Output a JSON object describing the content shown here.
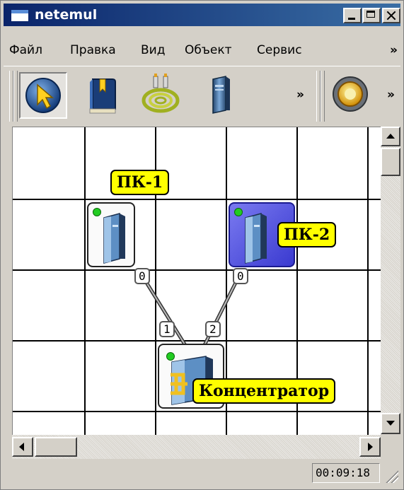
{
  "window": {
    "title": "netemul"
  },
  "menu": {
    "items": [
      "Файл",
      "Правка",
      "Вид",
      "Объект",
      "Сервис"
    ],
    "more": "»"
  },
  "toolbar": {
    "tools": [
      "pointer-tool",
      "note-tool",
      "cable-tool",
      "computer-tool"
    ],
    "more": "»",
    "settings": "settings-gear",
    "more2": "»"
  },
  "diagram": {
    "nodes": [
      {
        "name": "ПК-1",
        "type": "computer",
        "selected": false
      },
      {
        "name": "ПК-2",
        "type": "computer",
        "selected": true
      },
      {
        "name": "Концентратор",
        "type": "hub",
        "selected": false
      }
    ],
    "links": [
      {
        "from": "ПК-1",
        "from_port": "0",
        "to": "Концентратор",
        "to_port": "1"
      },
      {
        "from": "ПК-2",
        "from_port": "0",
        "to": "Концентратор",
        "to_port": "2"
      }
    ],
    "status_led_color": "#22cc22",
    "label_color": "#ffff00",
    "selection_color": "#3333ee"
  },
  "status": {
    "clock": "00:09:18"
  }
}
